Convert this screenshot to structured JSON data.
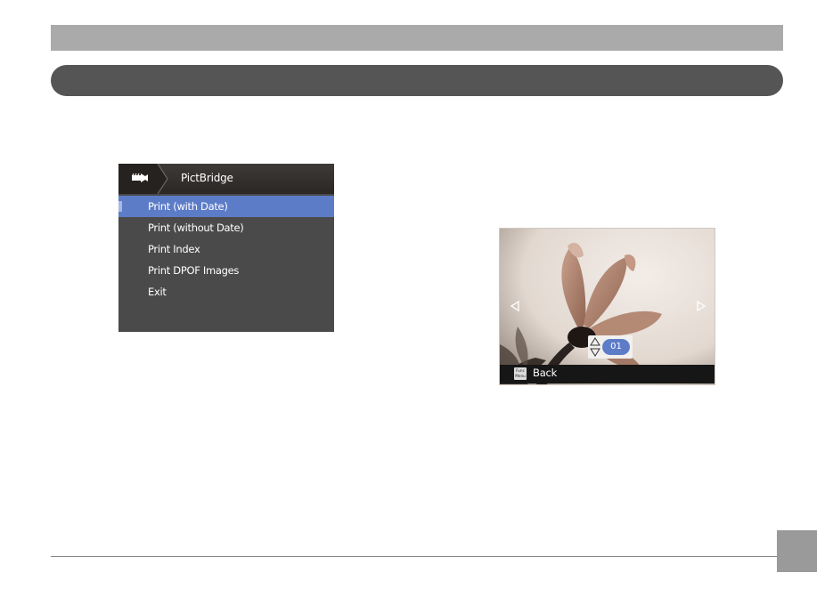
{
  "menu": {
    "title": "PictBridge",
    "items": [
      {
        "label": "Print (with Date)",
        "selected": true
      },
      {
        "label": "Print (without Date)",
        "selected": false
      },
      {
        "label": "Print Index",
        "selected": false
      },
      {
        "label": "Print DPOF Images",
        "selected": false
      },
      {
        "label": "Exit",
        "selected": false
      }
    ],
    "icon": "pictbridge-connection-icon"
  },
  "photo_screen": {
    "copies": "01",
    "back_label": "Back",
    "func_icon_text": "Func Menu",
    "icons": [
      "left-arrow-icon",
      "right-arrow-icon",
      "up-down-arrow-icon",
      "func-menu-icon"
    ]
  },
  "colors": {
    "header_bar": "#aaaaaa",
    "section_bar": "#555555",
    "selection": "#5d7cc8",
    "menu_bg": "#4a4a4a",
    "page_box": "#9a9a9a"
  }
}
